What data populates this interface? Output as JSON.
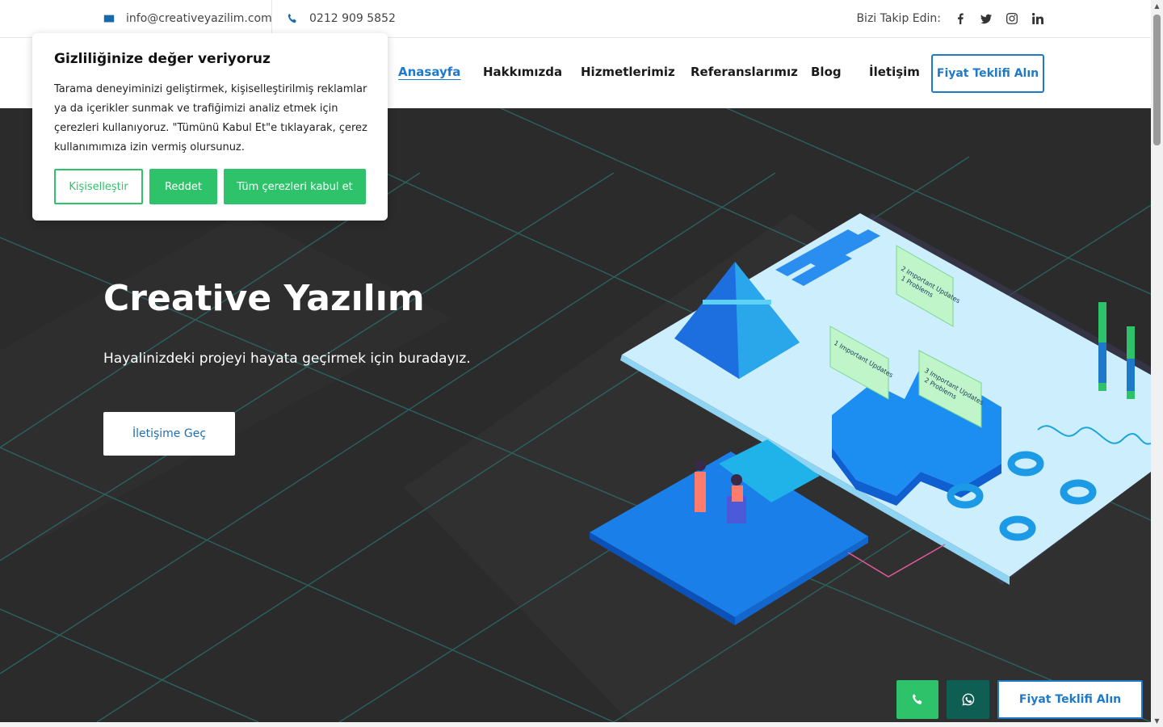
{
  "topbar": {
    "email": "info@creativeyazilim.com",
    "phone": "0212 909 5852",
    "follow_label": "Bizi Takip Edin:",
    "social_icons": [
      "facebook-icon",
      "twitter-icon",
      "instagram-icon",
      "linkedin-icon"
    ]
  },
  "nav": {
    "items": [
      "Anasayfa",
      "Hakkımızda",
      "Hizmetlerimiz",
      "Referanslarımız",
      "Blog",
      "İletişim"
    ],
    "active": "Anasayfa",
    "cta": "Fiyat Teklifi Alın"
  },
  "hero": {
    "title": "Creative Yazılım",
    "subtitle": "Hayalinizdeki projeyi hayata geçirmek için buradayız.",
    "cta": "İletişime Geç"
  },
  "illustration": {
    "labels": [
      "2 Important Updates",
      "1 Problems",
      "1 Important Updates",
      "3 Important Updates",
      "2 Problems"
    ]
  },
  "cookie": {
    "title": "Gizliliğinize değer veriyoruz",
    "text": "Tarama deneyiminizi geliştirmek, kişiselleştirilmiş reklamlar ya da içerikler sunmak ve trafiğimizi analiz etmek için çerezleri kullanıyoruz. \"Tümünü Kabul Et\"e tıklayarak, çerez kullanımımıza izin vermiş olursunuz.",
    "customize": "Kişiselleştir",
    "reject": "Reddet",
    "accept_all": "Tüm çerezleri kabul et"
  },
  "floating": {
    "quote": "Fiyat Teklifi Alın",
    "call_icon": "phone-icon",
    "whatsapp_icon": "whatsapp-icon"
  },
  "colors": {
    "accent_blue": "#1e7ac8",
    "green": "#2ec26a",
    "whatsapp": "#0f5e54",
    "hero_bg": "#2b2b2b"
  }
}
